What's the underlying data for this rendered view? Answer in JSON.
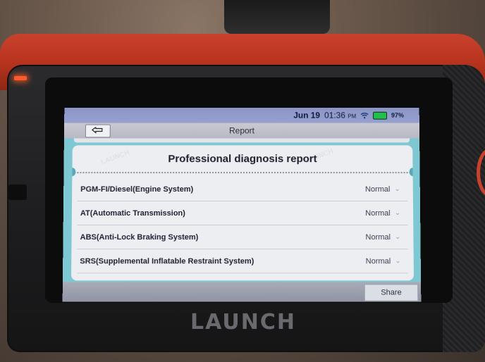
{
  "status_bar": {
    "date": "Jun 19",
    "time": "01:36",
    "ampm": "PM",
    "wifi_icon": "wifi-icon",
    "battery_icon": "battery-icon",
    "battery_pct": "97%"
  },
  "top_bar": {
    "back_icon": "back-arrow-icon",
    "title": "Report"
  },
  "report": {
    "title": "Professional diagnosis report",
    "rows": [
      {
        "label": "PGM-FI/Diesel(Engine System)",
        "status": "Normal"
      },
      {
        "label": "AT(Automatic Transmission)",
        "status": "Normal"
      },
      {
        "label": "ABS(Anti-Lock Braking System)",
        "status": "Normal"
      },
      {
        "label": "SRS(Supplemental Inflatable Restraint System)",
        "status": "Normal"
      }
    ]
  },
  "bottom_bar": {
    "share_label": "Share"
  },
  "device": {
    "brand": "LAUNCH"
  },
  "colors": {
    "accent": "#7ec8d4",
    "status_bar": "#8b95c8",
    "card": "#eceef2"
  }
}
